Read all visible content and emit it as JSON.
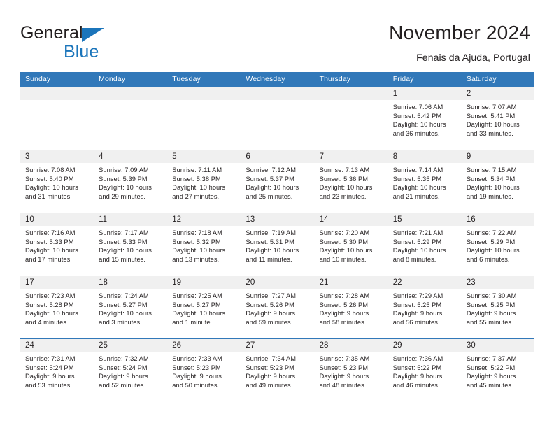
{
  "brand": {
    "name_part1": "General",
    "name_part2": "Blue",
    "flag_icon": "brand-flag-icon",
    "accent_color": "#1b75bb"
  },
  "header": {
    "title": "November 2024",
    "subtitle": "Fenais da Ajuda, Portugal"
  },
  "colors": {
    "header_blue": "#3178b9",
    "day_band_gray": "#f0f0f0",
    "text": "#231f20"
  },
  "calendar": {
    "weekday_headers": [
      "Sunday",
      "Monday",
      "Tuesday",
      "Wednesday",
      "Thursday",
      "Friday",
      "Saturday"
    ],
    "weeks": [
      [
        {
          "day": "",
          "lines": []
        },
        {
          "day": "",
          "lines": []
        },
        {
          "day": "",
          "lines": []
        },
        {
          "day": "",
          "lines": []
        },
        {
          "day": "",
          "lines": []
        },
        {
          "day": "1",
          "lines": [
            "Sunrise: 7:06 AM",
            "Sunset: 5:42 PM",
            "Daylight: 10 hours",
            "and 36 minutes."
          ]
        },
        {
          "day": "2",
          "lines": [
            "Sunrise: 7:07 AM",
            "Sunset: 5:41 PM",
            "Daylight: 10 hours",
            "and 33 minutes."
          ]
        }
      ],
      [
        {
          "day": "3",
          "lines": [
            "Sunrise: 7:08 AM",
            "Sunset: 5:40 PM",
            "Daylight: 10 hours",
            "and 31 minutes."
          ]
        },
        {
          "day": "4",
          "lines": [
            "Sunrise: 7:09 AM",
            "Sunset: 5:39 PM",
            "Daylight: 10 hours",
            "and 29 minutes."
          ]
        },
        {
          "day": "5",
          "lines": [
            "Sunrise: 7:11 AM",
            "Sunset: 5:38 PM",
            "Daylight: 10 hours",
            "and 27 minutes."
          ]
        },
        {
          "day": "6",
          "lines": [
            "Sunrise: 7:12 AM",
            "Sunset: 5:37 PM",
            "Daylight: 10 hours",
            "and 25 minutes."
          ]
        },
        {
          "day": "7",
          "lines": [
            "Sunrise: 7:13 AM",
            "Sunset: 5:36 PM",
            "Daylight: 10 hours",
            "and 23 minutes."
          ]
        },
        {
          "day": "8",
          "lines": [
            "Sunrise: 7:14 AM",
            "Sunset: 5:35 PM",
            "Daylight: 10 hours",
            "and 21 minutes."
          ]
        },
        {
          "day": "9",
          "lines": [
            "Sunrise: 7:15 AM",
            "Sunset: 5:34 PM",
            "Daylight: 10 hours",
            "and 19 minutes."
          ]
        }
      ],
      [
        {
          "day": "10",
          "lines": [
            "Sunrise: 7:16 AM",
            "Sunset: 5:33 PM",
            "Daylight: 10 hours",
            "and 17 minutes."
          ]
        },
        {
          "day": "11",
          "lines": [
            "Sunrise: 7:17 AM",
            "Sunset: 5:33 PM",
            "Daylight: 10 hours",
            "and 15 minutes."
          ]
        },
        {
          "day": "12",
          "lines": [
            "Sunrise: 7:18 AM",
            "Sunset: 5:32 PM",
            "Daylight: 10 hours",
            "and 13 minutes."
          ]
        },
        {
          "day": "13",
          "lines": [
            "Sunrise: 7:19 AM",
            "Sunset: 5:31 PM",
            "Daylight: 10 hours",
            "and 11 minutes."
          ]
        },
        {
          "day": "14",
          "lines": [
            "Sunrise: 7:20 AM",
            "Sunset: 5:30 PM",
            "Daylight: 10 hours",
            "and 10 minutes."
          ]
        },
        {
          "day": "15",
          "lines": [
            "Sunrise: 7:21 AM",
            "Sunset: 5:29 PM",
            "Daylight: 10 hours",
            "and 8 minutes."
          ]
        },
        {
          "day": "16",
          "lines": [
            "Sunrise: 7:22 AM",
            "Sunset: 5:29 PM",
            "Daylight: 10 hours",
            "and 6 minutes."
          ]
        }
      ],
      [
        {
          "day": "17",
          "lines": [
            "Sunrise: 7:23 AM",
            "Sunset: 5:28 PM",
            "Daylight: 10 hours",
            "and 4 minutes."
          ]
        },
        {
          "day": "18",
          "lines": [
            "Sunrise: 7:24 AM",
            "Sunset: 5:27 PM",
            "Daylight: 10 hours",
            "and 3 minutes."
          ]
        },
        {
          "day": "19",
          "lines": [
            "Sunrise: 7:25 AM",
            "Sunset: 5:27 PM",
            "Daylight: 10 hours",
            "and 1 minute."
          ]
        },
        {
          "day": "20",
          "lines": [
            "Sunrise: 7:27 AM",
            "Sunset: 5:26 PM",
            "Daylight: 9 hours",
            "and 59 minutes."
          ]
        },
        {
          "day": "21",
          "lines": [
            "Sunrise: 7:28 AM",
            "Sunset: 5:26 PM",
            "Daylight: 9 hours",
            "and 58 minutes."
          ]
        },
        {
          "day": "22",
          "lines": [
            "Sunrise: 7:29 AM",
            "Sunset: 5:25 PM",
            "Daylight: 9 hours",
            "and 56 minutes."
          ]
        },
        {
          "day": "23",
          "lines": [
            "Sunrise: 7:30 AM",
            "Sunset: 5:25 PM",
            "Daylight: 9 hours",
            "and 55 minutes."
          ]
        }
      ],
      [
        {
          "day": "24",
          "lines": [
            "Sunrise: 7:31 AM",
            "Sunset: 5:24 PM",
            "Daylight: 9 hours",
            "and 53 minutes."
          ]
        },
        {
          "day": "25",
          "lines": [
            "Sunrise: 7:32 AM",
            "Sunset: 5:24 PM",
            "Daylight: 9 hours",
            "and 52 minutes."
          ]
        },
        {
          "day": "26",
          "lines": [
            "Sunrise: 7:33 AM",
            "Sunset: 5:23 PM",
            "Daylight: 9 hours",
            "and 50 minutes."
          ]
        },
        {
          "day": "27",
          "lines": [
            "Sunrise: 7:34 AM",
            "Sunset: 5:23 PM",
            "Daylight: 9 hours",
            "and 49 minutes."
          ]
        },
        {
          "day": "28",
          "lines": [
            "Sunrise: 7:35 AM",
            "Sunset: 5:23 PM",
            "Daylight: 9 hours",
            "and 48 minutes."
          ]
        },
        {
          "day": "29",
          "lines": [
            "Sunrise: 7:36 AM",
            "Sunset: 5:22 PM",
            "Daylight: 9 hours",
            "and 46 minutes."
          ]
        },
        {
          "day": "30",
          "lines": [
            "Sunrise: 7:37 AM",
            "Sunset: 5:22 PM",
            "Daylight: 9 hours",
            "and 45 minutes."
          ]
        }
      ]
    ]
  }
}
